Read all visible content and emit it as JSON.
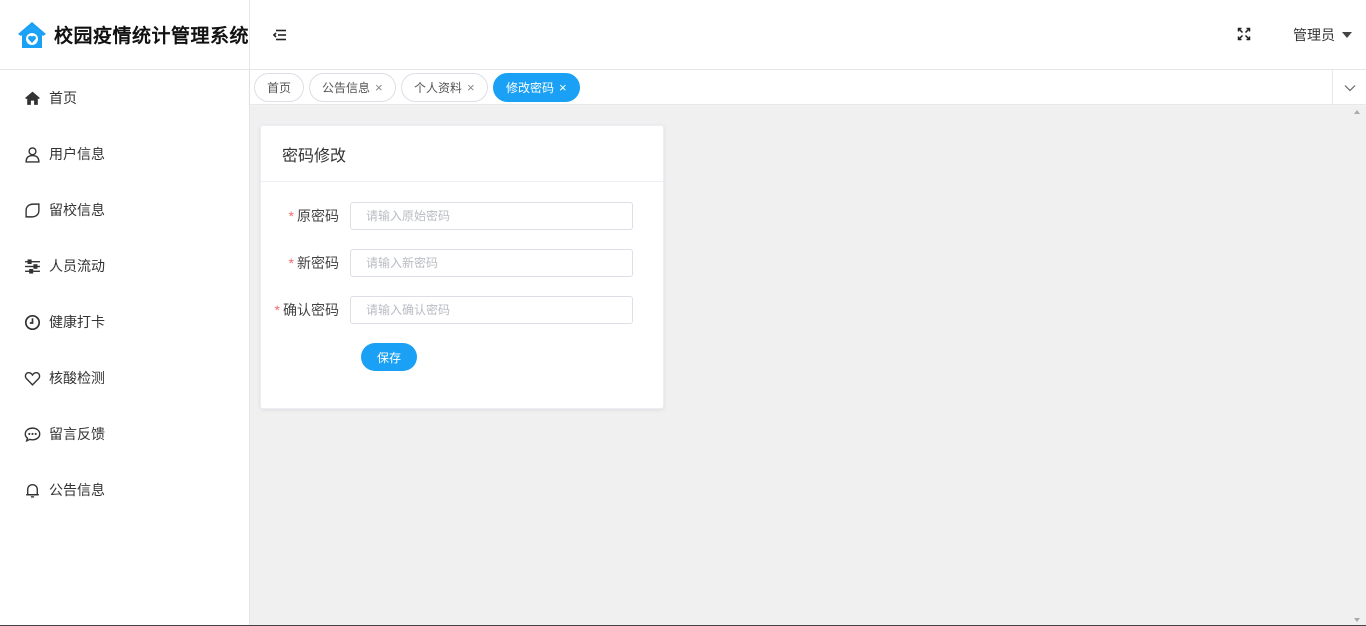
{
  "app": {
    "title": "校园疫情统计管理系统",
    "accent": "#1aa1f5"
  },
  "sidebar": {
    "items": [
      {
        "label": "首页",
        "icon": "home-icon"
      },
      {
        "label": "用户信息",
        "icon": "user-icon"
      },
      {
        "label": "留校信息",
        "icon": "leaf-icon"
      },
      {
        "label": "人员流动",
        "icon": "sliders-icon"
      },
      {
        "label": "健康打卡",
        "icon": "clock-icon"
      },
      {
        "label": "核酸检测",
        "icon": "heart-icon"
      },
      {
        "label": "留言反馈",
        "icon": "chat-icon"
      },
      {
        "label": "公告信息",
        "icon": "bell-icon"
      }
    ]
  },
  "header": {
    "user_label": "管理员"
  },
  "tabs": [
    {
      "label": "首页",
      "closable": false,
      "active": false
    },
    {
      "label": "公告信息",
      "closable": true,
      "active": false
    },
    {
      "label": "个人资料",
      "closable": true,
      "active": false
    },
    {
      "label": "修改密码",
      "closable": true,
      "active": true
    }
  ],
  "tab_close_glyph": "×",
  "form": {
    "title": "密码修改",
    "required_mark": "*",
    "fields": [
      {
        "label": "原密码",
        "placeholder": "请输入原始密码",
        "value": ""
      },
      {
        "label": "新密码",
        "placeholder": "请输入新密码",
        "value": ""
      },
      {
        "label": "确认密码",
        "placeholder": "请输入确认密码",
        "value": ""
      }
    ],
    "save_label": "保存"
  }
}
